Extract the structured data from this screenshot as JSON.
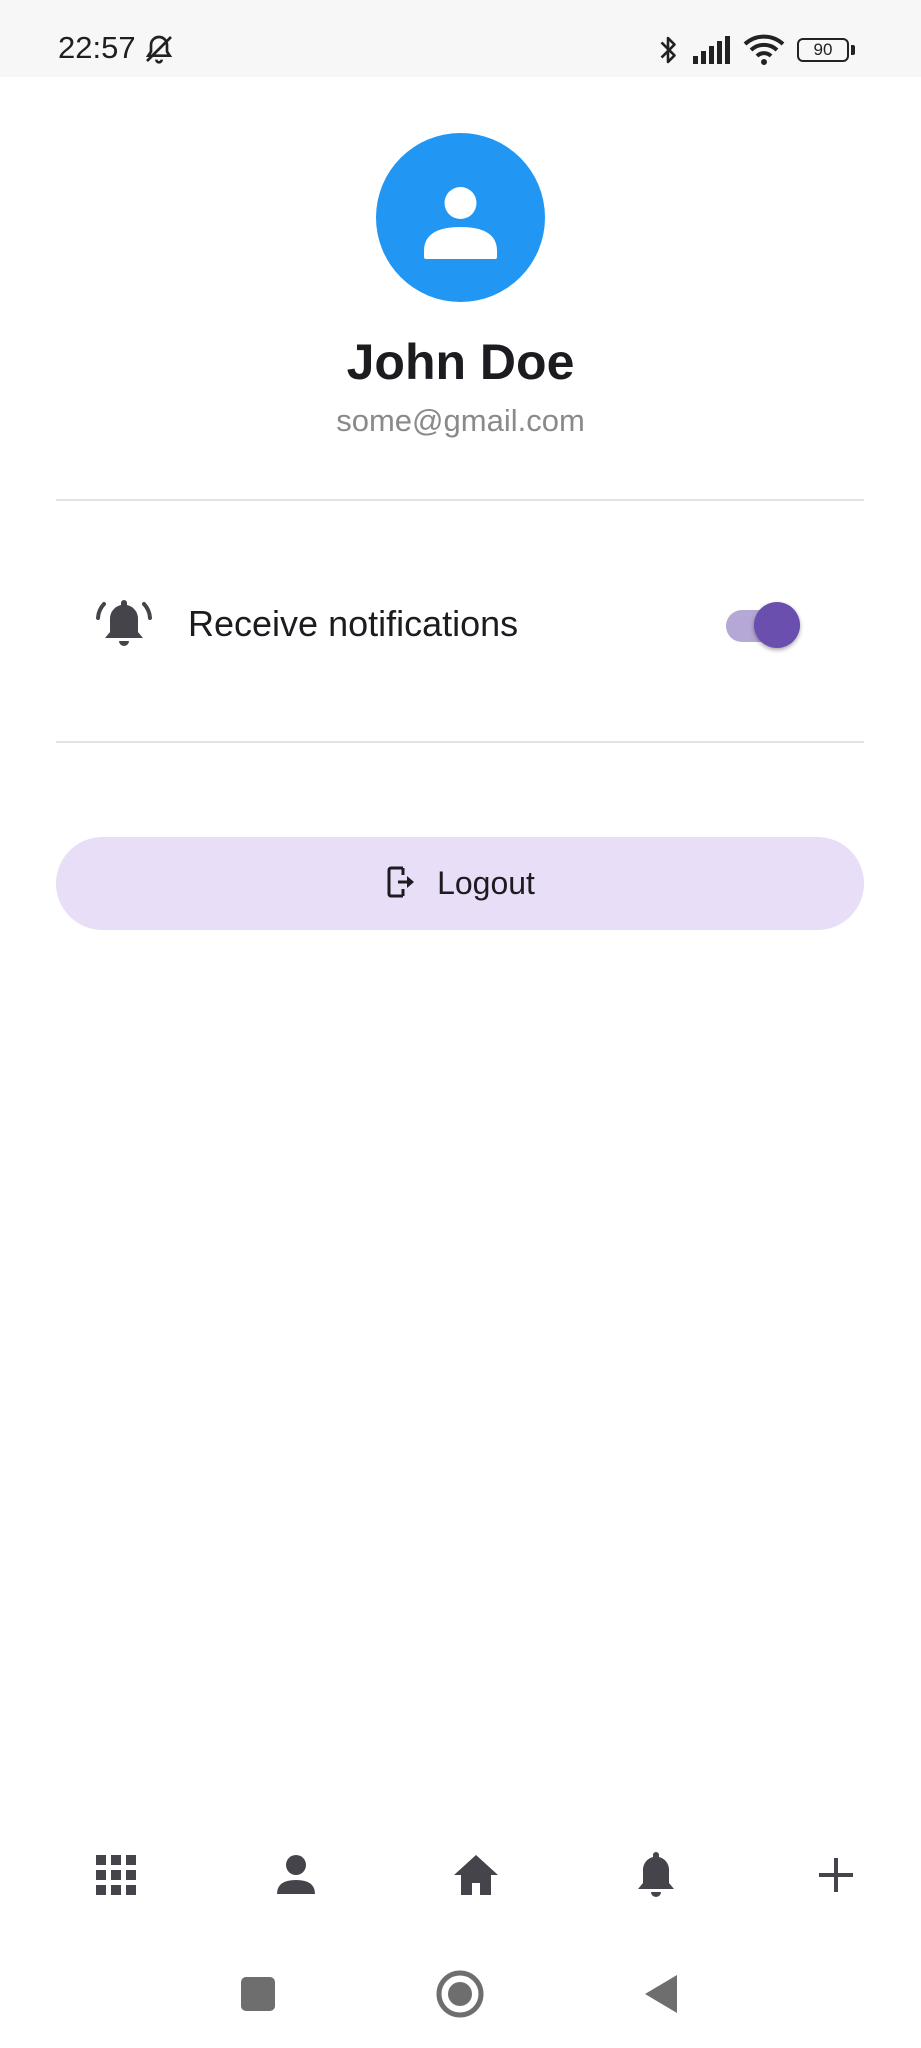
{
  "status_bar": {
    "time": "22:57",
    "battery": "90",
    "icons": [
      "bell-off-icon",
      "bluetooth-icon",
      "signal-icon",
      "wifi-icon",
      "battery-icon"
    ]
  },
  "profile": {
    "name": "John Doe",
    "email": "some@gmail.com",
    "avatar_color": "#2196f3"
  },
  "settings": {
    "notifications_label": "Receive notifications",
    "notifications_enabled": true,
    "switch_color": "#6a4fae"
  },
  "logout": {
    "label": "Logout",
    "background": "#e8def8"
  },
  "bottom_nav": {
    "items": [
      "apps-grid-icon",
      "person-icon",
      "home-icon",
      "bell-icon",
      "plus-icon"
    ]
  },
  "system_nav": {
    "items": [
      "recents-icon",
      "home-circle-icon",
      "back-icon"
    ]
  }
}
